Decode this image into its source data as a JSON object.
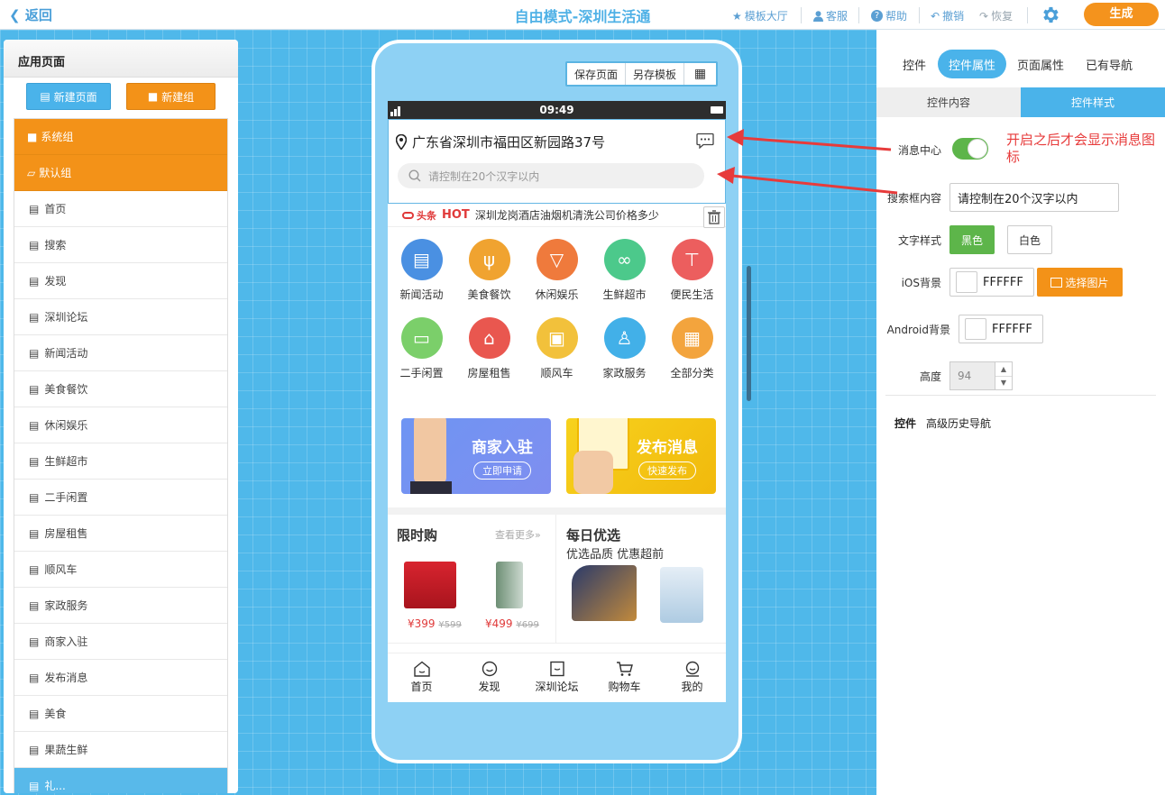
{
  "topbar": {
    "back": "返回",
    "title": "自由模式-深圳生活通",
    "template_hall": "模板大厅",
    "service": "客服",
    "help": "帮助",
    "undo": "撤销",
    "redo": "恢复",
    "generate": "生成"
  },
  "left": {
    "title": "应用页面",
    "new_page": "新建页面",
    "new_group": "新建组",
    "groups": [
      "系统组",
      "默认组"
    ],
    "pages": [
      "首页",
      "搜索",
      "发现",
      "深圳论坛",
      "新闻活动",
      "美食餐饮",
      "休闲娱乐",
      "生鲜超市",
      "二手闲置",
      "房屋租售",
      "顺风车",
      "家政服务",
      "商家入驻",
      "发布消息",
      "美食",
      "果蔬生鲜",
      "礼..."
    ]
  },
  "phone": {
    "save_page": "保存页面",
    "save_template": "另存模板",
    "time": "09:49",
    "address": "广东省深圳市福田区新园路37号",
    "search_placeholder": "请控制在20个汉字以内",
    "news_logo": "头条",
    "news_hot": "HOT",
    "news_text": "深圳龙岗酒店油烟机清洗公司价格多少",
    "categories": [
      {
        "label": "新闻活动",
        "color": "#4a90e2"
      },
      {
        "label": "美食餐饮",
        "color": "#f0a330"
      },
      {
        "label": "休闲娱乐",
        "color": "#ef7a3c"
      },
      {
        "label": "生鲜超市",
        "color": "#4cc98b"
      },
      {
        "label": "便民生活",
        "color": "#ec5e5e"
      },
      {
        "label": "二手闲置",
        "color": "#7bcf6a"
      },
      {
        "label": "房屋租售",
        "color": "#e9574f"
      },
      {
        "label": "顺风车",
        "color": "#f2c13b"
      },
      {
        "label": "家政服务",
        "color": "#42b0e8"
      },
      {
        "label": "全部分类",
        "color": "#f3a43d"
      }
    ],
    "banner1": {
      "title": "商家入驻",
      "btn": "立即申请"
    },
    "banner2": {
      "title": "发布消息",
      "btn": "快速发布"
    },
    "flash": {
      "title": "限时购",
      "more": "查看更多»",
      "p1": "¥399",
      "o1": "¥599",
      "p2": "¥499",
      "o2": "¥699"
    },
    "daily": {
      "title": "每日优选",
      "sub": "优选品质 优惠超前"
    },
    "nav": [
      "首页",
      "发现",
      "深圳论坛",
      "购物车",
      "我的"
    ]
  },
  "right": {
    "tabs": [
      "控件",
      "控件属性",
      "页面属性",
      "已有导航"
    ],
    "subtabs": [
      "控件内容",
      "控件样式"
    ],
    "msg_center": "消息中心",
    "annotation": "开启之后才会显示消息图标",
    "search_label": "搜索框内容",
    "search_value": "请控制在20个汉字以内",
    "text_style": "文字样式",
    "black": "黑色",
    "white": "白色",
    "ios_bg": "iOS背景",
    "ios_value": "FFFFFF",
    "choose_img": "选择图片",
    "android_bg": "Android背景",
    "android_value": "FFFFFF",
    "height": "高度",
    "height_value": "94",
    "footer_a": "控件",
    "footer_b": "高级历史导航"
  }
}
